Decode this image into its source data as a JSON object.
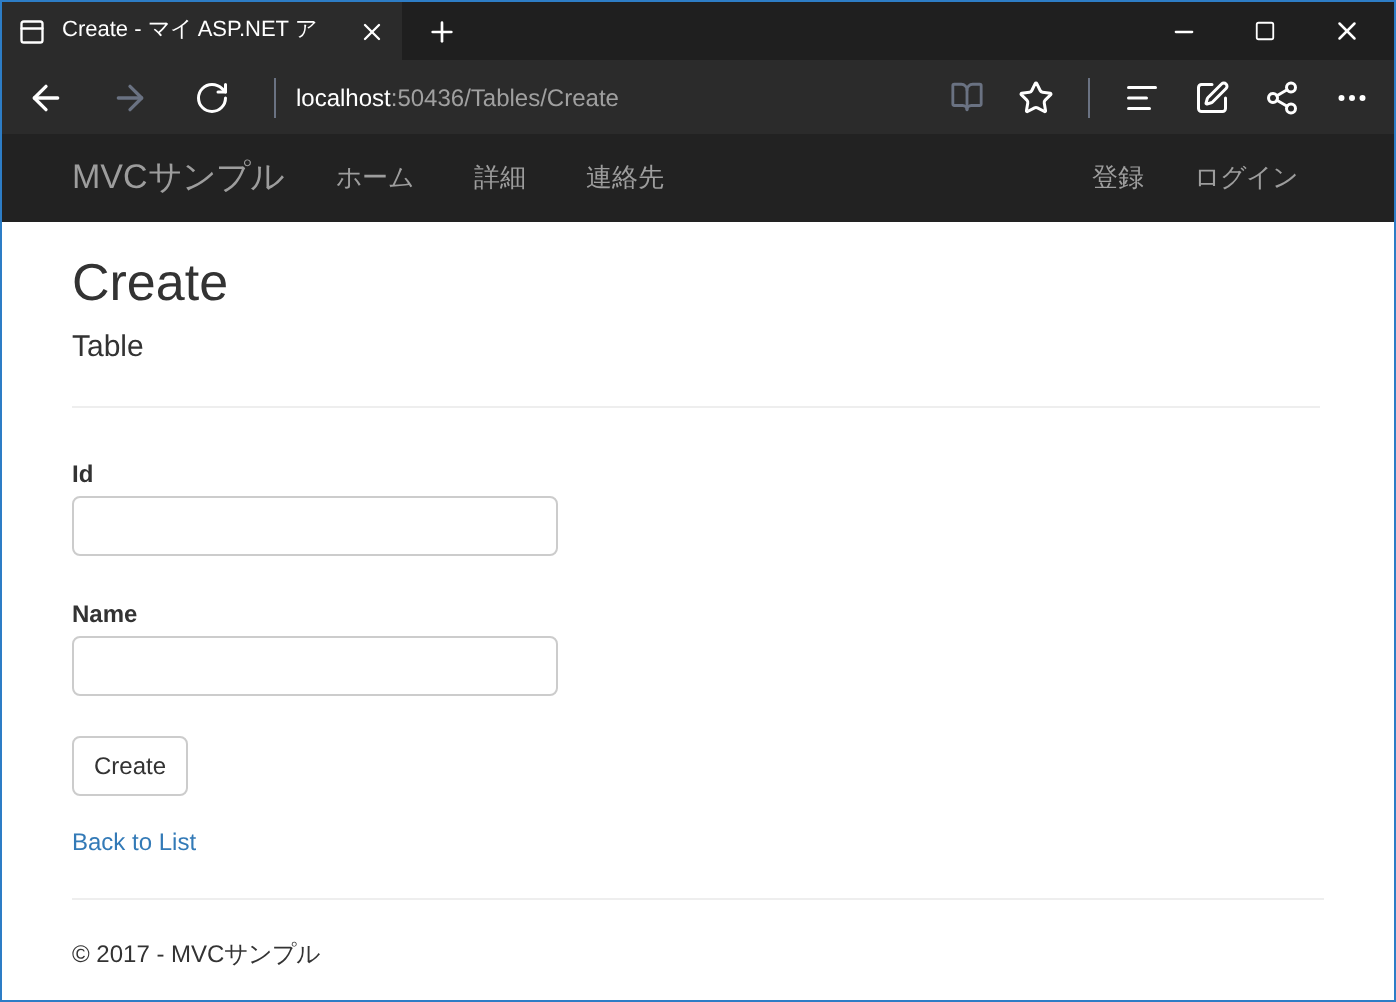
{
  "browser": {
    "tab_title": "Create - マイ ASP.NET ア",
    "address_host": "localhost",
    "address_rest": ":50436/Tables/Create"
  },
  "navbar": {
    "brand": "MVCサンプル",
    "links": [
      "ホーム",
      "詳細",
      "連絡先"
    ],
    "right_links": [
      "登録",
      "ログイン"
    ]
  },
  "page": {
    "title": "Create",
    "subtitle": "Table",
    "fields": [
      {
        "label": "Id"
      },
      {
        "label": "Name"
      }
    ],
    "submit": "Create",
    "back_link": "Back to List",
    "footer": "© 2017 - MVCサンプル"
  }
}
